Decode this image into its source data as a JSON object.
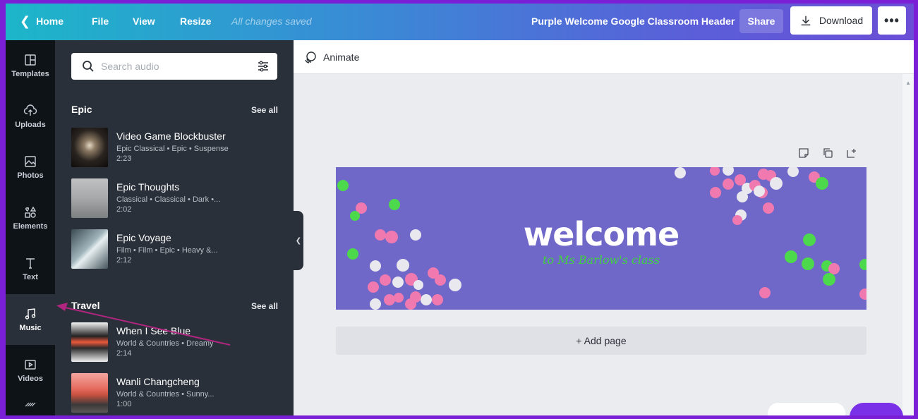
{
  "topbar": {
    "home_label": "Home",
    "file_label": "File",
    "view_label": "View",
    "resize_label": "Resize",
    "saved_status": "All changes saved",
    "design_title": "Purple Welcome Google Classroom Header",
    "share_label": "Share",
    "download_label": "Download",
    "more_label": "•••"
  },
  "rail": {
    "items": [
      {
        "label": "Templates",
        "icon": "templates-icon"
      },
      {
        "label": "Uploads",
        "icon": "upload-cloud-icon"
      },
      {
        "label": "Photos",
        "icon": "photo-icon"
      },
      {
        "label": "Elements",
        "icon": "shapes-icon"
      },
      {
        "label": "Text",
        "icon": "text-icon"
      },
      {
        "label": "Music",
        "icon": "music-note-icon",
        "active": true
      },
      {
        "label": "Videos",
        "icon": "video-icon"
      }
    ]
  },
  "panel": {
    "search_placeholder": "Search audio",
    "sections": [
      {
        "title": "Epic",
        "see_all": "See all",
        "tracks": [
          {
            "name": "Video Game Blockbuster",
            "tags": "Epic Classical • Epic • Suspense",
            "duration": "2:23"
          },
          {
            "name": "Epic Thoughts",
            "tags": "Classical • Classical • Dark •...",
            "duration": "2:02"
          },
          {
            "name": "Epic Voyage",
            "tags": "Film • Film • Epic • Heavy &...",
            "duration": "2:12"
          }
        ]
      },
      {
        "title": "Travel",
        "see_all": "See all",
        "tracks": [
          {
            "name": "When I See Blue",
            "tags": "World & Countries • Dreamy",
            "duration": "2:14"
          },
          {
            "name": "Wanli Changcheng",
            "tags": "World & Countries • Sunny...",
            "duration": "1:00"
          }
        ]
      }
    ]
  },
  "canvas": {
    "animate_label": "Animate",
    "design_heading": "welcome",
    "design_subheading": "to Ms Barlow's class",
    "add_page_label": "+ Add page"
  },
  "colors": {
    "accent_purple": "#7a1fd6",
    "design_bg": "#7068c8",
    "confetti_pink": "#f07ab0",
    "confetti_green": "#4cd94c",
    "confetti_white": "#e8e8ee"
  }
}
